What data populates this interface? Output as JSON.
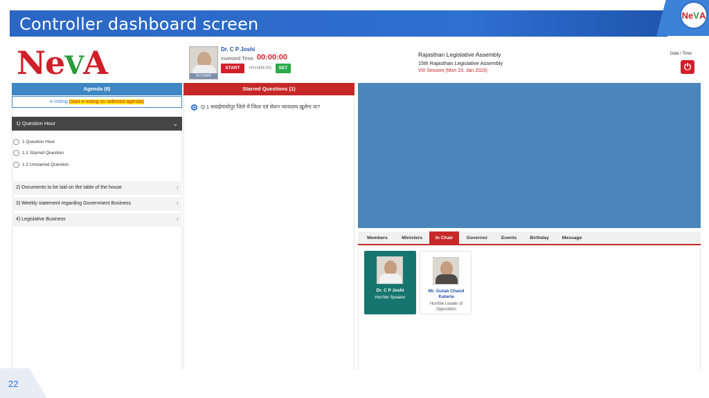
{
  "slide": {
    "title": "Controller dashboard screen",
    "page_number": "22"
  },
  "brand": {
    "logo_left": "Ne",
    "logo_leaf": "V",
    "logo_right": "A"
  },
  "corner_logo": {
    "left": "Ne",
    "mid": "V",
    "right": "A"
  },
  "speaker": {
    "name": "Dr. C P Joshi",
    "invested_label": "Invested Time:",
    "invested_time": "00:00:00",
    "start_label": "START",
    "time_placeholder": "HH:MM:SS",
    "set_label": "SET",
    "photo_tag": "IN CHAIR"
  },
  "assembly": {
    "line1": "Rajasthan Legislative Assembly",
    "line2": "15th Rajasthan Legislative Assembly",
    "line3": "VIII Session (Mon 23, Jan 2023)",
    "datetime_label": "Date / Time:"
  },
  "agenda": {
    "header": "Agenda (8)",
    "evote_label": "e-Voting",
    "evote_hint": "(start e-voting on selected agenda)",
    "question_hour": "1) Question Hour",
    "options": [
      "1 Question Hour",
      "1.1 Starred Question",
      "1.2 Unstarred Question"
    ],
    "items": [
      "2) Documents to be laid on the table of the house",
      "3) Weekly statement regarding Government Business",
      "4) Legislative Business"
    ]
  },
  "starred": {
    "header": "Starred Questions (1)",
    "question": "Q.1 सवाईमाधोपुर जिले में जिला एवं सेशन न्यायालय खुलेगा या?"
  },
  "tabs": [
    "Members",
    "Ministers",
    "In Chair",
    "Governor",
    "Events",
    "Birthday",
    "Message"
  ],
  "active_tab": "In Chair",
  "cards": [
    {
      "name": "Dr. C P Joshi",
      "role": "Hon'ble Speaker"
    },
    {
      "name": "Mr. Gulab Chand Kataria",
      "role": "Hon'ble Leader of Opposition"
    }
  ],
  "colors": {
    "banner": "#2e6fd0",
    "agenda_header": "#3e86c4",
    "starred_header": "#c62828",
    "display": "#4a86bb",
    "active_card": "#16756f"
  }
}
